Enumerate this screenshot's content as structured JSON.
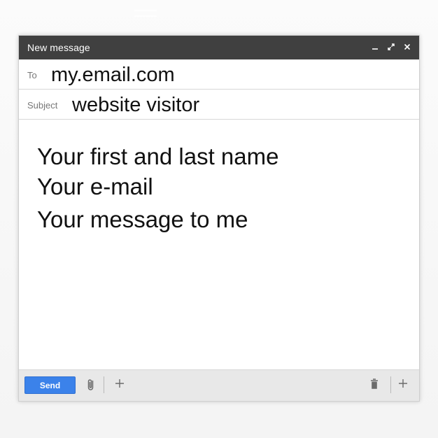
{
  "window": {
    "title": "New message",
    "controls": {
      "minimize": "minimize-icon",
      "expand": "expand-icon",
      "close": "close-icon"
    }
  },
  "fields": {
    "to_label": "To",
    "to_value": "my.email.com",
    "subject_label": "Subject",
    "subject_value": "website visitor"
  },
  "message": {
    "lines": [
      "Your first and last name",
      "Your e-mail",
      "Your message to me"
    ]
  },
  "toolbar": {
    "send_label": "Send",
    "icons": {
      "attach": "paperclip-icon",
      "insert": "plus-icon",
      "delete": "trash-icon",
      "more": "plus-icon"
    }
  },
  "colors": {
    "title_bar": "#404040",
    "send_button": "#3b82ea",
    "toolbar": "#e8e8e8"
  }
}
